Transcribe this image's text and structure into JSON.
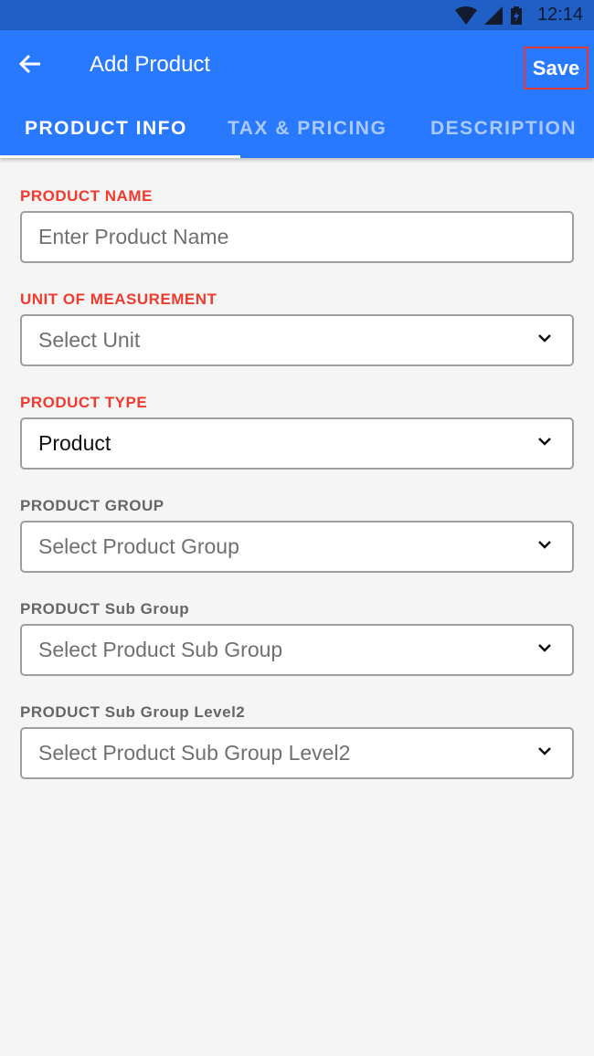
{
  "status": {
    "time": "12:14",
    "icons": [
      "wifi-icon",
      "signal-icon",
      "battery-charging-icon"
    ]
  },
  "appbar": {
    "title": "Add Product",
    "save_label": "Save",
    "back_icon": "arrow-left-icon"
  },
  "tabs": [
    {
      "label": "PRODUCT INFO",
      "active": true
    },
    {
      "label": "TAX & PRICING"
    },
    {
      "label": "DESCRIPTION"
    }
  ],
  "colors": {
    "primary": "#2979ff",
    "status_bar": "#1f5fc6",
    "required_label": "#f03a2e",
    "optional_label": "#666666"
  },
  "fields": [
    {
      "label": "PRODUCT NAME",
      "placeholder": "Enter Product Name",
      "required": true
    },
    {
      "label": "UNIT OF MEASUREMENT",
      "placeholder": "Select Unit",
      "required": true
    },
    {
      "label": "PRODUCT TYPE",
      "value": "Product",
      "required": true
    },
    {
      "label": "PRODUCT GROUP",
      "placeholder": "Select Product Group"
    },
    {
      "label": "PRODUCT Sub Group",
      "placeholder": "Select Product Sub Group"
    },
    {
      "label": "PRODUCT Sub Group Level2",
      "placeholder": "Select Product Sub Group Level2"
    }
  ]
}
